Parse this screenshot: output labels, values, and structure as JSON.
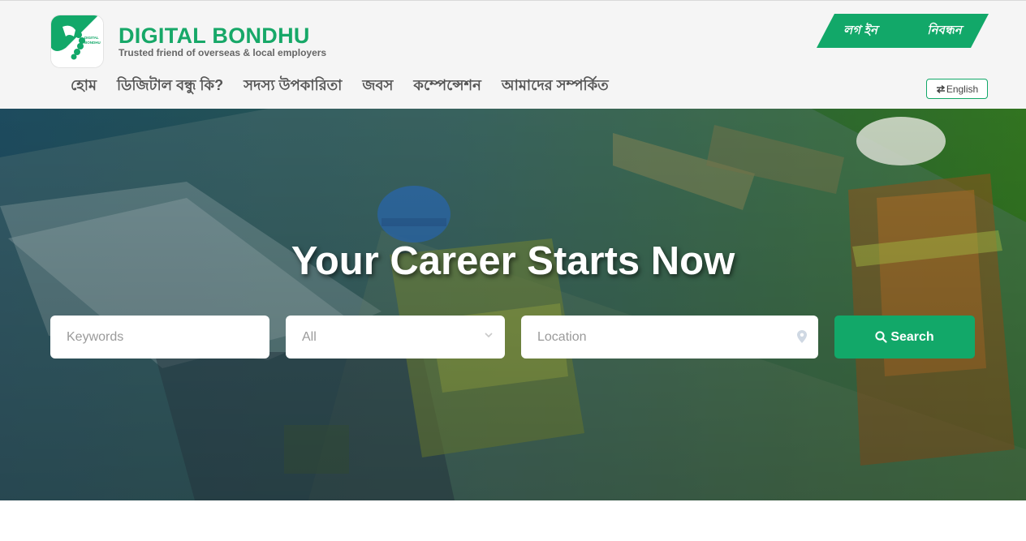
{
  "brand": {
    "name": "DIGITAL BONDHU",
    "tagline": "Trusted friend of overseas & local employers",
    "logo_text_line1": "DIGITAL",
    "logo_text_line2": "BONDHU"
  },
  "auth": {
    "login_label": "লগ ইন",
    "register_label": "নিবন্ধন"
  },
  "nav": {
    "items": [
      {
        "label": "হোম"
      },
      {
        "label": "ডিজিটাল বন্ধু কি?"
      },
      {
        "label": "সদস্য উপকারিতা"
      },
      {
        "label": "জবস"
      },
      {
        "label": "কম্পেন্সেশন"
      },
      {
        "label": "আমাদের সম্পর্কিত"
      }
    ]
  },
  "language": {
    "icon": "exchange-icon",
    "label": "English"
  },
  "hero": {
    "title": "Your Career Starts Now",
    "keywords_placeholder": "Keywords",
    "category_value": "All",
    "location_placeholder": "Location",
    "search_label": "Search"
  },
  "colors": {
    "brand_green": "#12a869",
    "header_bg": "#f5f5f5",
    "nav_text": "#555555"
  },
  "icons": {
    "category": "chevron-down-icon",
    "location": "map-marker-icon",
    "search": "search-icon"
  }
}
